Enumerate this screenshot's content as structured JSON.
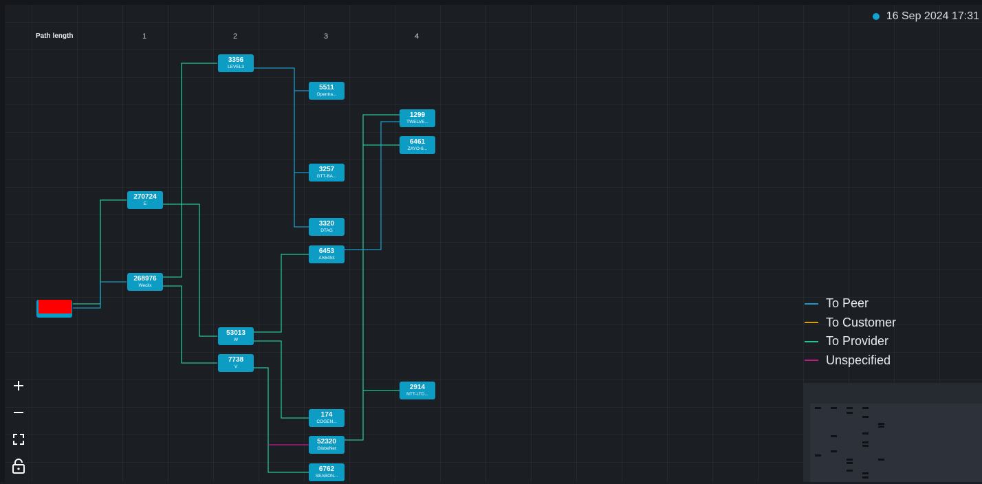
{
  "header": {
    "columns": [
      "Path length",
      "1",
      "2",
      "3",
      "4"
    ],
    "timestamp": "16 Sep 2024 17:31"
  },
  "colors": {
    "to_peer": "#1a9bc5",
    "to_customer": "#d4a017",
    "to_provider": "#26c39b",
    "unspecified": "#c2188a",
    "node": "#0d9cc4",
    "status_dot": "#11a3cf"
  },
  "nodes": {
    "origin": {
      "asn": "",
      "name": ""
    },
    "n270724": {
      "asn": "270724",
      "name": "E"
    },
    "n268976": {
      "asn": "268976",
      "name": "Weclix"
    },
    "n3356": {
      "asn": "3356",
      "name": "LEVEL3"
    },
    "n53013": {
      "asn": "53013",
      "name": "W"
    },
    "n7738": {
      "asn": "7738",
      "name": "V"
    },
    "n5511": {
      "asn": "5511",
      "name": "Opentra..."
    },
    "n3257": {
      "asn": "3257",
      "name": "GTT-BA..."
    },
    "n3320": {
      "asn": "3320",
      "name": "DTAG"
    },
    "n6453": {
      "asn": "6453",
      "name": "AS6453"
    },
    "n174": {
      "asn": "174",
      "name": "COGEN..."
    },
    "n52320": {
      "asn": "52320",
      "name": "GlobeNet"
    },
    "n6762": {
      "asn": "6762",
      "name": "SEABON..."
    },
    "n1299": {
      "asn": "1299",
      "name": "TWELVE..."
    },
    "n6461": {
      "asn": "6461",
      "name": "ZAYO-6..."
    },
    "n2914": {
      "asn": "2914",
      "name": "NTT-LTD..."
    }
  },
  "legend": [
    {
      "label": "To Peer",
      "color": "#1a9bc5"
    },
    {
      "label": "To Customer",
      "color": "#d4a017"
    },
    {
      "label": "To Provider",
      "color": "#26c39b"
    },
    {
      "label": "Unspecified",
      "color": "#c2188a"
    }
  ],
  "controls": {
    "zoom_in": "plus-icon",
    "zoom_out": "minus-icon",
    "fit_view": "fullscreen-icon",
    "lock": "lock-icon"
  }
}
